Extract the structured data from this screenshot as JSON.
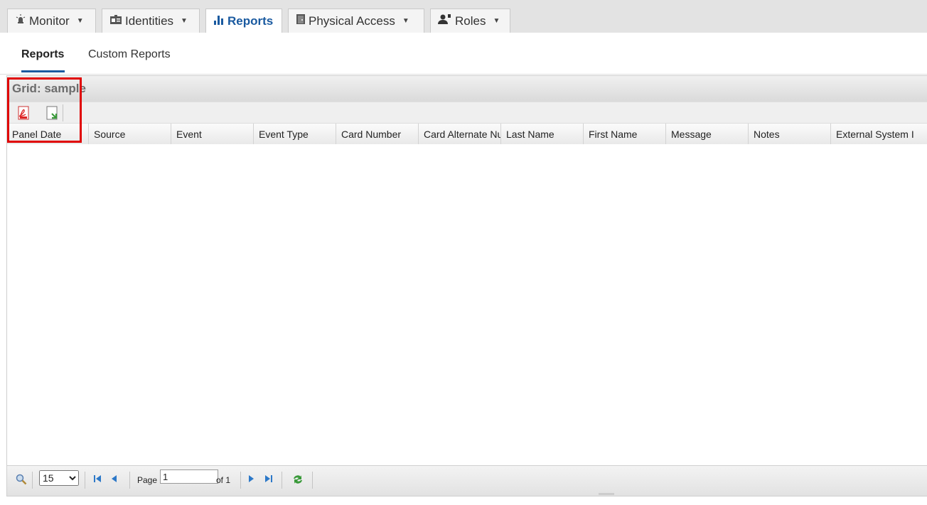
{
  "tabs": [
    {
      "label": "Monitor",
      "icon": "alarm-light-icon",
      "active": false
    },
    {
      "label": "Identities",
      "icon": "id-card-icon",
      "active": false
    },
    {
      "label": "Reports",
      "icon": "bar-chart-icon",
      "active": true
    },
    {
      "label": "Physical Access",
      "icon": "door-icon",
      "active": false
    },
    {
      "label": "Roles",
      "icon": "users-icon",
      "active": false
    }
  ],
  "subnav": {
    "items": [
      "Reports",
      "Custom Reports"
    ],
    "active": "Reports"
  },
  "grid": {
    "title": "Grid: sample",
    "toolbar": [
      "pdf-export-icon",
      "excel-export-icon"
    ],
    "columns": [
      "Panel Date",
      "Source",
      "Event",
      "Event Type",
      "Card Number",
      "Card Alternate Nu",
      "Last Name",
      "First Name",
      "Message",
      "Notes",
      "External System I"
    ],
    "rows": []
  },
  "pager": {
    "page_size": "15",
    "page_label": "Page",
    "page_value": "1",
    "of_label": "of 1"
  },
  "colors": {
    "accent": "#1a5aa0",
    "highlight": "#e00000"
  }
}
